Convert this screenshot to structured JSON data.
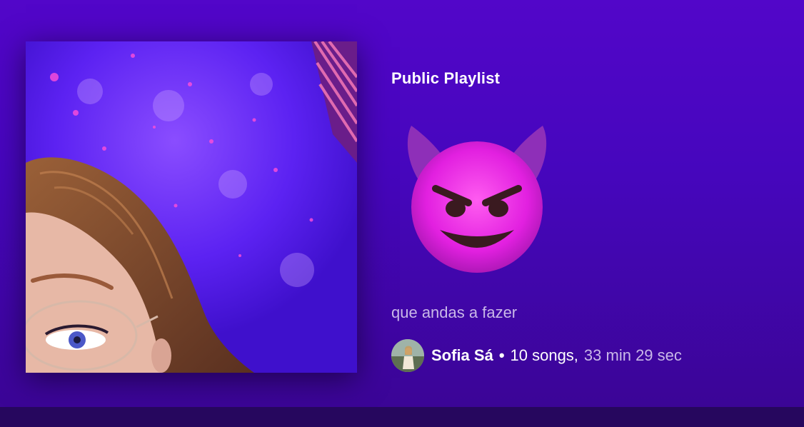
{
  "playlist": {
    "type_label": "Public Playlist",
    "title_emoji": "😈",
    "description": "que andas a fazer",
    "owner_name": "Sofia Sá",
    "separator": "•",
    "song_count": "10 songs,",
    "duration": "33 min 29 sec"
  },
  "colors": {
    "background_top": "#5206c9",
    "background_bottom": "#3a0593",
    "muted_text": "#c9b8e8",
    "bottom_bar": "#26075e"
  }
}
